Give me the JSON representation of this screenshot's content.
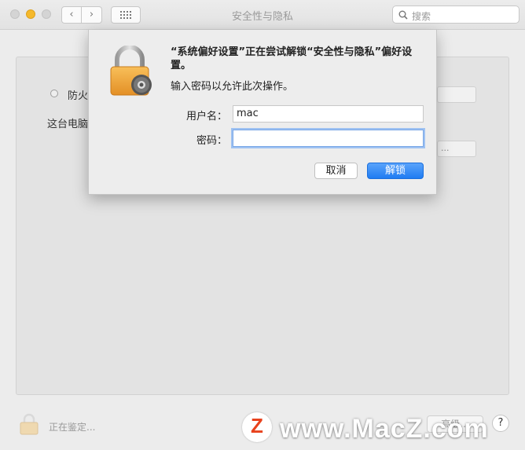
{
  "window": {
    "title": "安全性与隐私",
    "search_placeholder": "搜索"
  },
  "background": {
    "firewall_label": "防火",
    "computer_label": "这台电脑",
    "field2_text": "..."
  },
  "bottom": {
    "status": "正在鉴定...",
    "advanced_label": "高级...",
    "help_label": "?"
  },
  "dialog": {
    "title": "“系统偏好设置”正在尝试解锁“安全性与隐私”偏好设置。",
    "subtitle": "输入密码以允许此次操作。",
    "username_label": "用户名：",
    "username_value": "mac",
    "password_label": "密码：",
    "password_value": "",
    "cancel_label": "取消",
    "unlock_label": "解锁"
  },
  "watermark": {
    "logo_letter": "Z",
    "text": "www.MacZ.com"
  },
  "colors": {
    "accent": "#1f7cf2",
    "minimize": "#f5b92c",
    "lock_gold": "#f0a33a",
    "watermark_red": "#e8421d"
  }
}
